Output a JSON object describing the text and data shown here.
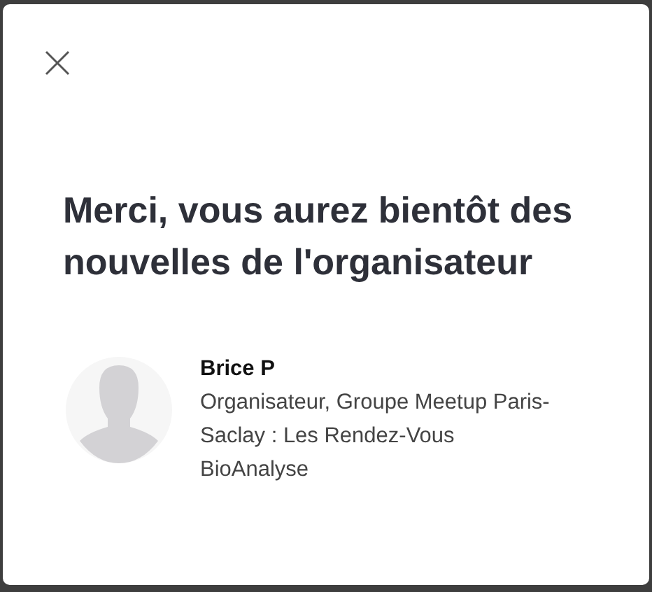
{
  "dialog": {
    "heading": "Merci, vous aurez bientôt des nouvelles de l'organisateur",
    "organizer": {
      "name": "Brice P",
      "description": "Organisateur, Groupe Meetup Paris-Saclay : Les Rendez-Vous BioAnalyse"
    }
  }
}
